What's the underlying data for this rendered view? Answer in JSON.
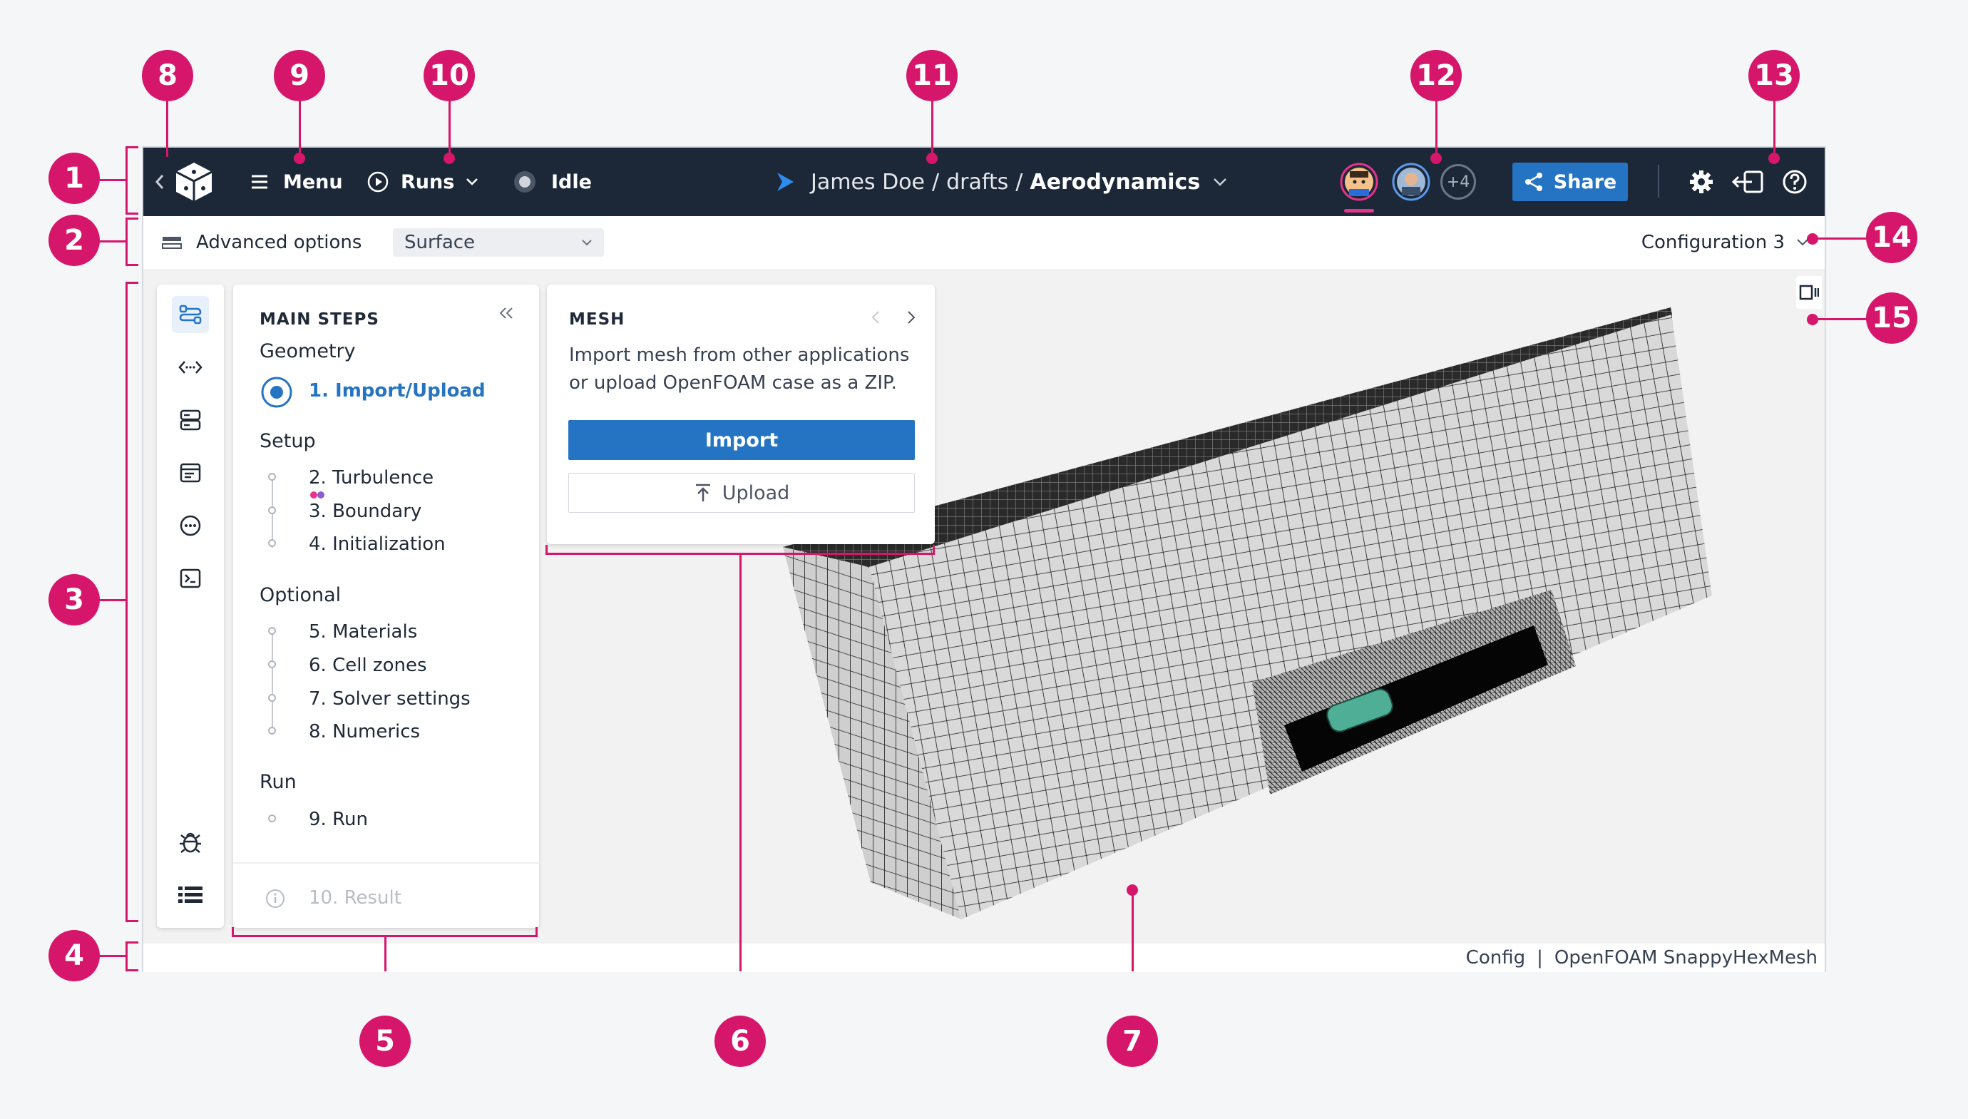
{
  "topbar": {
    "menu_label": "Menu",
    "runs_label": "Runs",
    "status_label": "Idle",
    "breadcrumb": {
      "owner": "James Doe",
      "sep1": "/",
      "folder": "drafts",
      "sep2": "/",
      "project": "Aerodynamics"
    },
    "extra_users": "+4",
    "share_label": "Share"
  },
  "subbar": {
    "advanced_options": "Advanced options",
    "surface_value": "Surface",
    "configuration": "Configuration 3"
  },
  "steps": {
    "title": "MAIN STEPS",
    "geometry": "Geometry",
    "import_upload": "1. Import/Upload",
    "setup": "Setup",
    "setup_items": [
      "2. Turbulence",
      "3. Boundary",
      "4. Initialization"
    ],
    "optional": "Optional",
    "optional_items": [
      "5. Materials",
      "6. Cell zones",
      "7. Solver settings",
      "8. Numerics"
    ],
    "run": "Run",
    "run_item": "9. Run",
    "result": "10. Result"
  },
  "mesh": {
    "title": "MESH",
    "description_line1": "Import mesh from other applications",
    "description_line2": "or upload OpenFOAM case as a ZIP.",
    "import_label": "Import",
    "upload_label": "Upload"
  },
  "statusbar": {
    "config": "Config",
    "sep": "|",
    "solver": "OpenFOAM SnappyHexMesh"
  },
  "callouts": [
    "1",
    "2",
    "3",
    "4",
    "5",
    "6",
    "7",
    "8",
    "9",
    "10",
    "11",
    "12",
    "13",
    "14",
    "15"
  ],
  "colors": {
    "accent": "#d6166b",
    "topbar": "#1c2838",
    "primary": "#2574c4"
  },
  "icons": [
    "logo-cube-icon",
    "chevron-left-icon",
    "hamburger-icon",
    "play-circle-icon",
    "chevron-down-icon",
    "status-dot-icon",
    "arrow-icon",
    "share-icon",
    "gear-icon",
    "exit-icon",
    "help-icon",
    "advanced-options-icon",
    "flow-icon",
    "code-icon",
    "server-icon",
    "window-icon",
    "sliders-icon",
    "terminal-icon",
    "bug-icon",
    "list-icon",
    "collapse-icon",
    "radio-icon",
    "info-icon",
    "upload-icon",
    "split-view-icon"
  ]
}
